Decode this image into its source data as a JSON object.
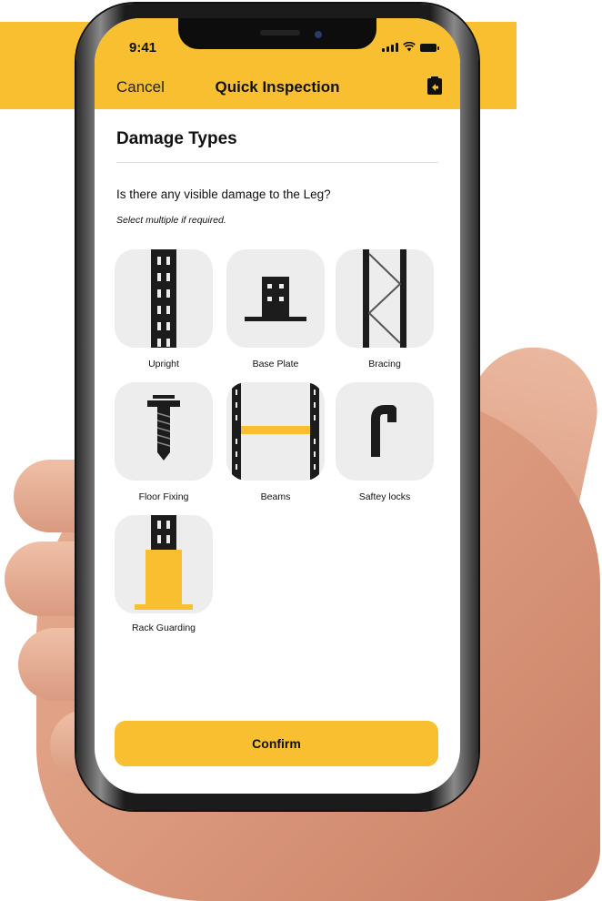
{
  "status_bar": {
    "time": "9:41"
  },
  "nav": {
    "cancel_label": "Cancel",
    "title": "Quick Inspection",
    "clipboard_icon": "clipboard-icon"
  },
  "content": {
    "section_title": "Damage Types",
    "question": "Is there any visible damage to the Leg?",
    "hint": "Select multiple if required.",
    "options": [
      {
        "label": "Upright",
        "icon": "upright-icon"
      },
      {
        "label": "Base Plate",
        "icon": "base-plate-icon"
      },
      {
        "label": "Bracing",
        "icon": "bracing-icon"
      },
      {
        "label": "Floor Fixing",
        "icon": "floor-fixing-icon"
      },
      {
        "label": "Beams",
        "icon": "beams-icon"
      },
      {
        "label": "Saftey locks",
        "icon": "safety-lock-icon"
      },
      {
        "label": "Rack Guarding",
        "icon": "rack-guarding-icon"
      }
    ],
    "confirm_label": "Confirm"
  },
  "colors": {
    "accent": "#F8C031",
    "tile": "#EDEDED",
    "text": "#111111"
  }
}
